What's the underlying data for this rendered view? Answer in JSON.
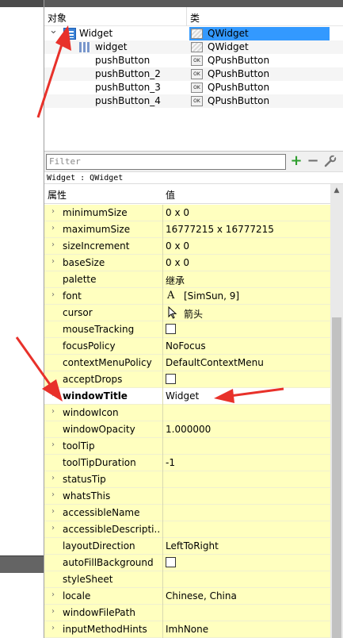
{
  "object_inspector": {
    "columns": {
      "object": "对象",
      "class": "类"
    },
    "rows": [
      {
        "name": "Widget",
        "class": "QWidget",
        "level": 0,
        "expanded": true,
        "selected": true,
        "icon": "form-icon"
      },
      {
        "name": "widget",
        "class": "QWidget",
        "level": 1,
        "icon": "grid-layout-icon"
      },
      {
        "name": "pushButton",
        "class": "QPushButton",
        "level": 1
      },
      {
        "name": "pushButton_2",
        "class": "QPushButton",
        "level": 1
      },
      {
        "name": "pushButton_3",
        "class": "QPushButton",
        "level": 1
      },
      {
        "name": "pushButton_4",
        "class": "QPushButton",
        "level": 1
      }
    ],
    "button_icon_text": "OK"
  },
  "filter": {
    "placeholder": "Filter",
    "add": "+",
    "remove": "−",
    "configure": "wrench"
  },
  "context_label": "Widget : QWidget",
  "property_editor": {
    "columns": {
      "property": "属性",
      "value": "值"
    },
    "rows": [
      {
        "name": "minimumSize",
        "value": "0 x 0",
        "expandable": true
      },
      {
        "name": "maximumSize",
        "value": "16777215 x 16777215",
        "expandable": true
      },
      {
        "name": "sizeIncrement",
        "value": "0 x 0",
        "expandable": true
      },
      {
        "name": "baseSize",
        "value": "0 x 0",
        "expandable": true
      },
      {
        "name": "palette",
        "value": "继承",
        "expandable": false
      },
      {
        "name": "font",
        "value": "[SimSun, 9]",
        "expandable": true,
        "value_icon": "A"
      },
      {
        "name": "cursor",
        "value": "箭头",
        "expandable": false,
        "value_icon": "arrow-cursor-icon"
      },
      {
        "name": "mouseTracking",
        "value": "",
        "expandable": false,
        "checkbox": true
      },
      {
        "name": "focusPolicy",
        "value": "NoFocus",
        "expandable": false
      },
      {
        "name": "contextMenuPolicy",
        "value": "DefaultContextMenu",
        "expandable": false
      },
      {
        "name": "acceptDrops",
        "value": "",
        "expandable": false,
        "checkbox": true
      },
      {
        "name": "windowTitle",
        "value": "Widget",
        "expandable": true,
        "bold": true,
        "white": true
      },
      {
        "name": "windowIcon",
        "value": "",
        "expandable": true
      },
      {
        "name": "windowOpacity",
        "value": "1.000000",
        "expandable": false
      },
      {
        "name": "toolTip",
        "value": "",
        "expandable": true
      },
      {
        "name": "toolTipDuration",
        "value": "-1",
        "expandable": false
      },
      {
        "name": "statusTip",
        "value": "",
        "expandable": true
      },
      {
        "name": "whatsThis",
        "value": "",
        "expandable": true
      },
      {
        "name": "accessibleName",
        "value": "",
        "expandable": true
      },
      {
        "name": "accessibleDescripti...",
        "value": "",
        "expandable": true
      },
      {
        "name": "layoutDirection",
        "value": "LeftToRight",
        "expandable": false
      },
      {
        "name": "autoFillBackground",
        "value": "",
        "expandable": false,
        "checkbox": true
      },
      {
        "name": "styleSheet",
        "value": "",
        "expandable": false
      },
      {
        "name": "locale",
        "value": "Chinese, China",
        "expandable": true
      },
      {
        "name": "windowFilePath",
        "value": "",
        "expandable": true
      },
      {
        "name": "inputMethodHints",
        "value": "ImhNone",
        "expandable": true
      }
    ]
  },
  "colors": {
    "selection": "#3399ff",
    "property_row": "#ffffbf",
    "annotation_arrow": "#e8312a",
    "add_icon": "#2e9e2e"
  }
}
